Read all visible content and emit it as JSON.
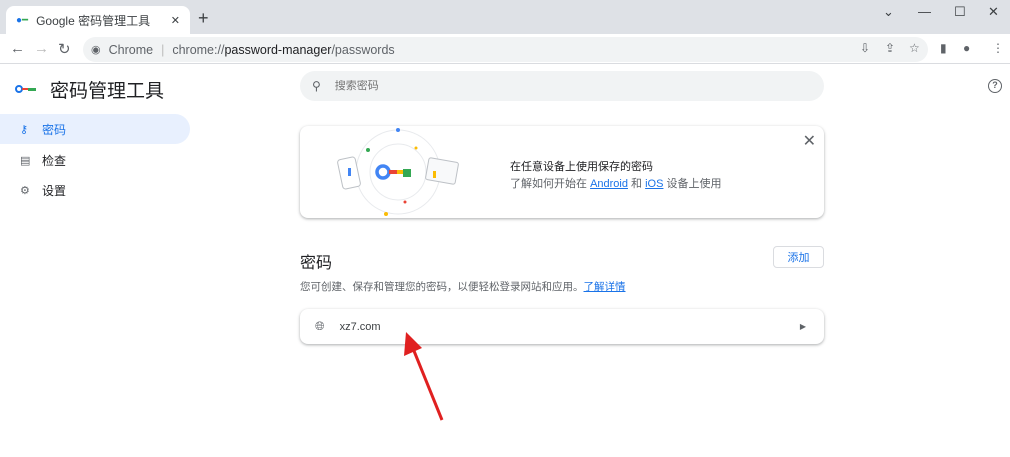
{
  "browser": {
    "tab_title": "Google 密码管理工具",
    "omnibox_label": "Chrome",
    "url_scheme": "chrome://",
    "url_host": "password-manager",
    "url_path": "/passwords"
  },
  "app": {
    "title": "密码管理工具",
    "search_placeholder": "搜索密码"
  },
  "sidebar": {
    "items": [
      {
        "label": "密码",
        "icon": "key-icon",
        "active": true
      },
      {
        "label": "检查",
        "icon": "clipboard-check-icon"
      },
      {
        "label": "设置",
        "icon": "gear-icon"
      }
    ]
  },
  "promo": {
    "title": "在任意设备上使用保存的密码",
    "text_before": "了解如何开始在 ",
    "link_android": "Android",
    "text_mid": " 和 ",
    "link_ios": "iOS",
    "text_after": " 设备上使用"
  },
  "passwords": {
    "heading": "密码",
    "add_label": "添加",
    "description": "您可创建、保存和管理您的密码，以便轻松登录网站和应用。",
    "learn_more": "了解详情",
    "items": [
      {
        "site": "xz7.com"
      }
    ]
  },
  "colors": {
    "accent": "#1a73e8",
    "arrow": "#e02020"
  }
}
